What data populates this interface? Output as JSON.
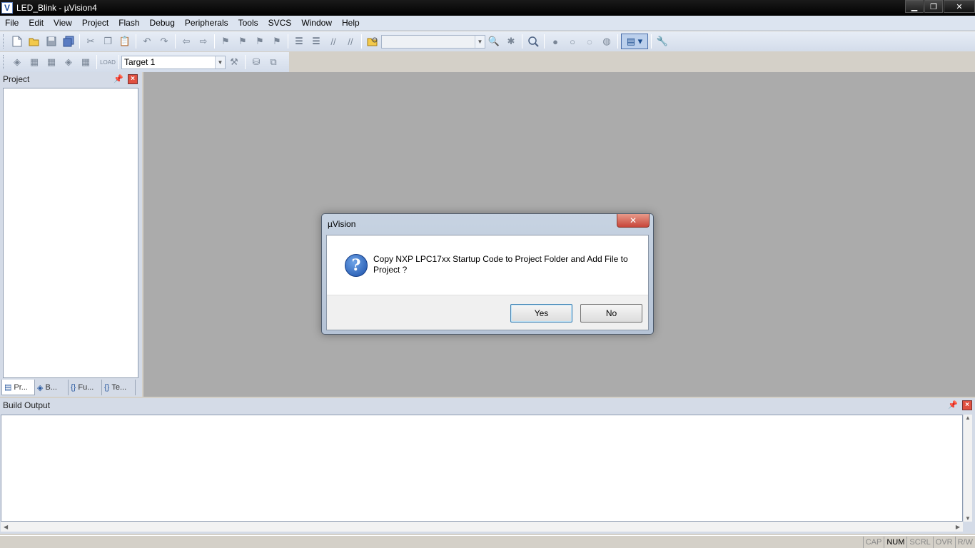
{
  "window": {
    "title": "LED_Blink  - µVision4",
    "app_icon_glyph": "V",
    "minimize_glyph": "▁",
    "restore_glyph": "❐",
    "close_glyph": "✕"
  },
  "menu": [
    {
      "label": "File"
    },
    {
      "label": "Edit"
    },
    {
      "label": "View"
    },
    {
      "label": "Project"
    },
    {
      "label": "Flash"
    },
    {
      "label": "Debug"
    },
    {
      "label": "Peripherals"
    },
    {
      "label": "Tools"
    },
    {
      "label": "SVCS"
    },
    {
      "label": "Window"
    },
    {
      "label": "Help"
    }
  ],
  "toolbar2": {
    "target_value": "Target 1"
  },
  "project_pane": {
    "title": "Project",
    "tabs": [
      {
        "label": "Pr...",
        "icon": "project-icon"
      },
      {
        "label": "B...",
        "icon": "books-icon"
      },
      {
        "label": "Fu...",
        "icon": "functions-icon"
      },
      {
        "label": "Te...",
        "icon": "templates-icon"
      }
    ]
  },
  "build_output": {
    "title": "Build Output"
  },
  "status_bar": [
    {
      "label": "CAP",
      "on": false
    },
    {
      "label": "NUM",
      "on": true
    },
    {
      "label": "SCRL",
      "on": false
    },
    {
      "label": "OVR",
      "on": false
    },
    {
      "label": "R/W",
      "on": false
    }
  ],
  "dialog": {
    "title": "µVision",
    "message": "Copy NXP LPC17xx Startup Code to Project Folder and Add File to Project ?",
    "yes_label": "Yes",
    "no_label": "No",
    "close_glyph": "✕",
    "icon_glyph": "?"
  },
  "colors": {
    "editor_background": "#ababab",
    "pane_background": "#d4dbe7",
    "toolbar_background": "#dce4f0",
    "title_bar": "#000000"
  }
}
